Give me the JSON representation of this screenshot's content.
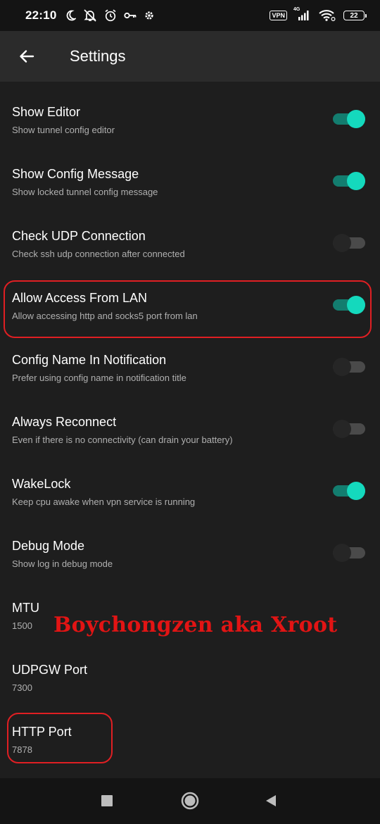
{
  "status_bar": {
    "time": "22:10",
    "vpn_label": "VPN",
    "network_label": "4G",
    "battery_level": "22",
    "left_icons": [
      "moon-icon",
      "notifications-off-icon",
      "alarm-icon",
      "key-icon",
      "gear-icon"
    ],
    "right_icons": [
      "vpn-badge",
      "signal-icon",
      "wifi-icon",
      "battery-icon"
    ]
  },
  "appbar": {
    "back_icon": "arrow-left-icon",
    "title": "Settings"
  },
  "settings": [
    {
      "title": "Show Editor",
      "subtitle": "Show tunnel config editor",
      "toggle": true
    },
    {
      "title": "Show Config Message",
      "subtitle": "Show locked tunnel config message",
      "toggle": true
    },
    {
      "title": "Check UDP Connection",
      "subtitle": "Check ssh udp connection after connected",
      "toggle": false
    },
    {
      "title": "Allow Access From LAN",
      "subtitle": "Allow accessing http and socks5 port from lan",
      "toggle": true
    },
    {
      "title": "Config Name In Notification",
      "subtitle": "Prefer using config name in notification title",
      "toggle": false
    },
    {
      "title": "Always Reconnect",
      "subtitle": "Even if there is no connectivity (can drain your battery)",
      "toggle": false
    },
    {
      "title": "WakeLock",
      "subtitle": "Keep cpu awake when vpn service is running",
      "toggle": true
    },
    {
      "title": "Debug Mode",
      "subtitle": "Show log in debug mode",
      "toggle": false
    },
    {
      "title": "MTU",
      "subtitle": "1500"
    },
    {
      "title": "UDPGW Port",
      "subtitle": "7300"
    },
    {
      "title": "HTTP Port",
      "subtitle": "7878"
    }
  ],
  "watermark": "Boychongzen aka Xroot",
  "colors": {
    "toggle_on_thumb": "#14d9bd",
    "toggle_on_track": "#137d6f",
    "highlight": "#e01f23",
    "watermark": "#e21414"
  },
  "nav_bar": {
    "icons": [
      "recents-square-icon",
      "home-circle-icon",
      "back-triangle-icon"
    ]
  }
}
